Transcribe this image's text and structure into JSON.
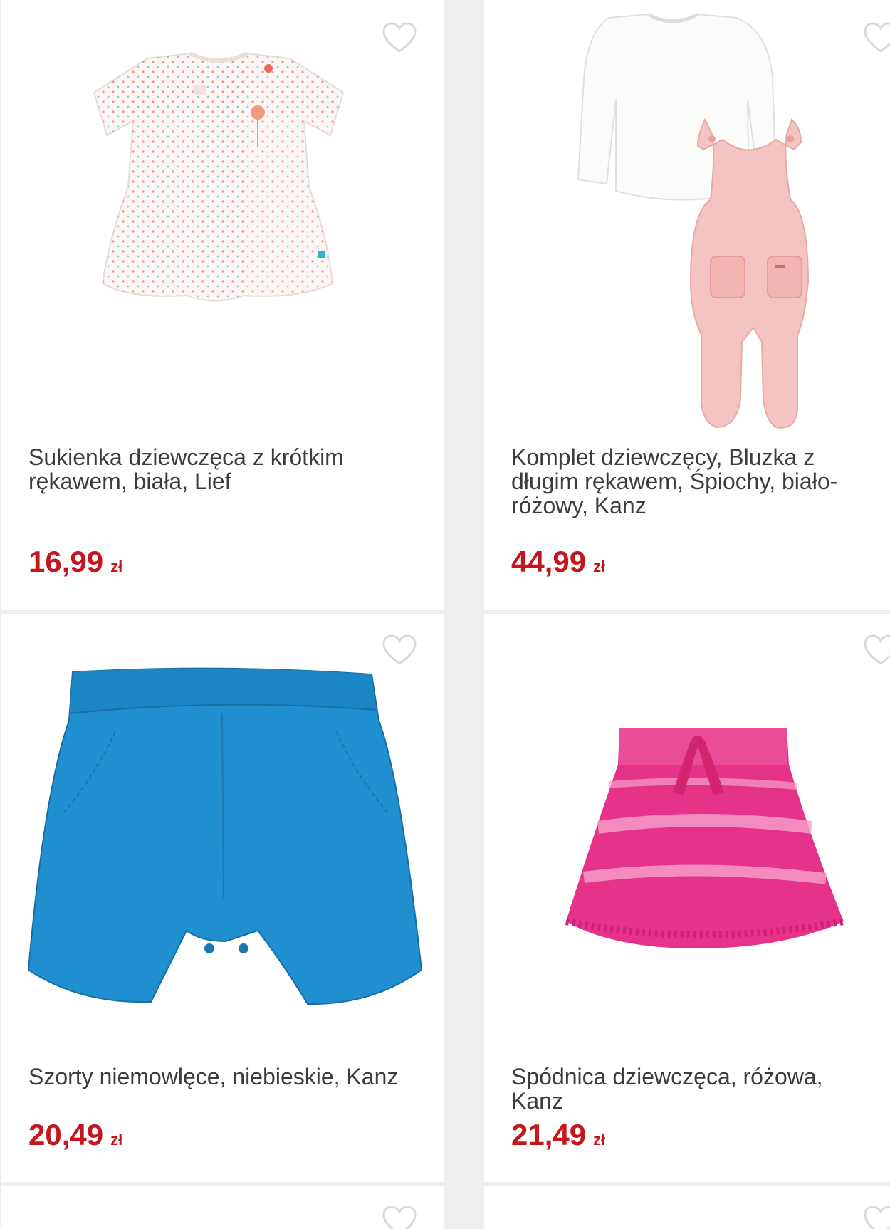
{
  "products": [
    {
      "title": "Sukienka dziewczęca z krótkim rękawem, biała, Lief",
      "price": "16,99",
      "currency": "zł",
      "favorite_icon": "heart-outline-icon"
    },
    {
      "title": "Komplet dziewczęcy, Bluzka z długim rękawem, Śpiochy, biało-różowy, Kanz",
      "price": "44,99",
      "currency": "zł",
      "favorite_icon": "heart-outline-icon"
    },
    {
      "title": "Szorty niemowlęce, niebieskie, Kanz",
      "price": "20,49",
      "currency": "zł",
      "favorite_icon": "heart-outline-icon"
    },
    {
      "title": "Spódnica dziewczęca, różowa, Kanz",
      "price": "21,49",
      "currency": "zł",
      "favorite_icon": "heart-outline-icon"
    }
  ],
  "colors": {
    "price": "#c5161d",
    "title": "#3c3c3c",
    "background": "#eeeeee",
    "card": "#ffffff",
    "heart": "#d9d9d9"
  }
}
